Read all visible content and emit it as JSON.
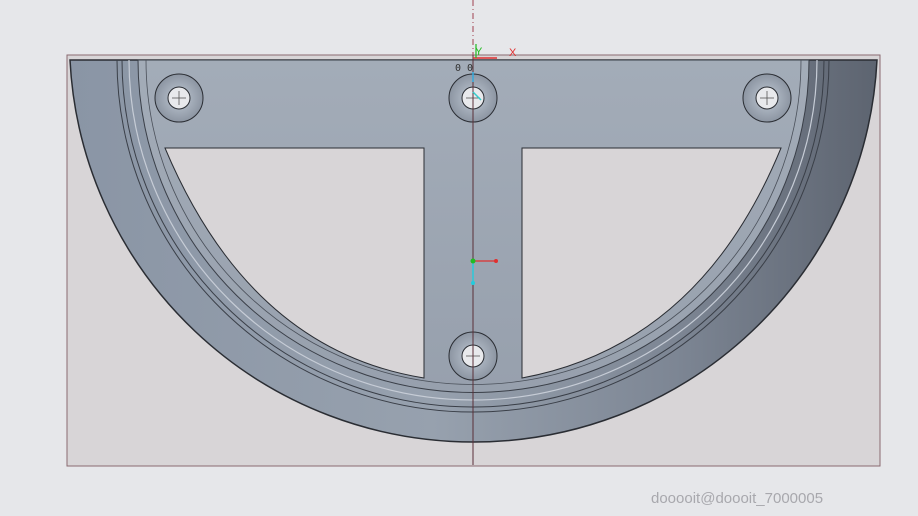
{
  "viewport": {
    "background_color": "#e6e7ea",
    "sketch_plane_color": "#d8d5d7",
    "part_color": "#9aa4b1"
  },
  "axes": {
    "y_label": "Y",
    "x_label": "X",
    "origin_label": "0 0",
    "y_color": "#22bb22",
    "x_color": "#e03030"
  },
  "watermark": {
    "text": "dooooit@doooit_7000005"
  }
}
